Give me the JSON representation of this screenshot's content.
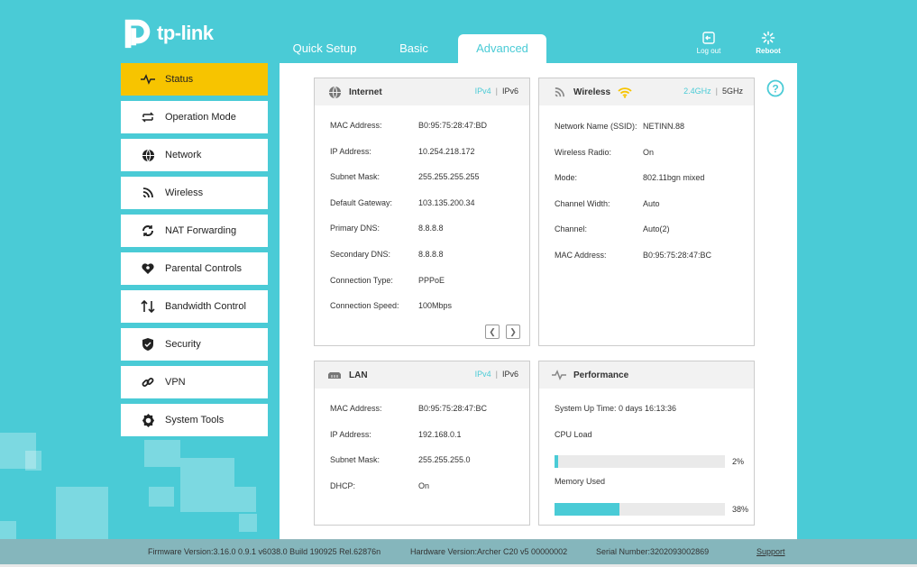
{
  "brand": {
    "logo_text": "tp-link"
  },
  "tabs": [
    {
      "label": "Quick Setup"
    },
    {
      "label": "Basic"
    },
    {
      "label": "Advanced",
      "active": true
    }
  ],
  "header_buttons": {
    "logout": "Log out",
    "reboot": "Reboot"
  },
  "sidebar": {
    "items": [
      {
        "label": "Status",
        "icon": "pulse-icon",
        "active": true
      },
      {
        "label": "Operation Mode",
        "icon": "switch-arrows-icon"
      },
      {
        "label": "Network",
        "icon": "globe-icon"
      },
      {
        "label": "Wireless",
        "icon": "wifi-icon"
      },
      {
        "label": "NAT Forwarding",
        "icon": "refresh-icon"
      },
      {
        "label": "Parental Controls",
        "icon": "heart-icon"
      },
      {
        "label": "Bandwidth Control",
        "icon": "up-down-arrows-icon"
      },
      {
        "label": "Security",
        "icon": "shield-icon"
      },
      {
        "label": "VPN",
        "icon": "link-icon"
      },
      {
        "label": "System Tools",
        "icon": "gear-icon"
      }
    ]
  },
  "internet": {
    "title": "Internet",
    "ipv4": "IPv4",
    "ipv6": "IPv6",
    "rows": [
      {
        "label": "MAC Address:",
        "value": "B0:95:75:28:47:BD"
      },
      {
        "label": "IP Address:",
        "value": "10.254.218.172"
      },
      {
        "label": "Subnet Mask:",
        "value": "255.255.255.255"
      },
      {
        "label": "Default Gateway:",
        "value": "103.135.200.34"
      },
      {
        "label": "Primary DNS:",
        "value": "8.8.8.8"
      },
      {
        "label": "Secondary DNS:",
        "value": "8.8.8.8"
      },
      {
        "label": "Connection Type:",
        "value": "PPPoE"
      },
      {
        "label": "Connection Speed:",
        "value": "100Mbps"
      }
    ]
  },
  "wireless": {
    "title": "Wireless",
    "band24": "2.4GHz",
    "band5": "5GHz",
    "rows": [
      {
        "label": "Network Name (SSID):",
        "value": "NETINN.88"
      },
      {
        "label": "Wireless Radio:",
        "value": "On"
      },
      {
        "label": "Mode:",
        "value": "802.11bgn mixed"
      },
      {
        "label": "Channel Width:",
        "value": "Auto"
      },
      {
        "label": "Channel:",
        "value": "Auto(2)"
      },
      {
        "label": "MAC Address:",
        "value": "B0:95:75:28:47:BC"
      }
    ]
  },
  "lan": {
    "title": "LAN",
    "ipv4": "IPv4",
    "ipv6": "IPv6",
    "rows": [
      {
        "label": "MAC Address:",
        "value": "B0:95:75:28:47:BC"
      },
      {
        "label": "IP Address:",
        "value": "192.168.0.1"
      },
      {
        "label": "Subnet Mask:",
        "value": "255.255.255.0"
      },
      {
        "label": "DHCP:",
        "value": "On"
      }
    ]
  },
  "performance": {
    "title": "Performance",
    "uptime": "System Up Time: 0 days 16:13:36",
    "cpu_label": "CPU Load",
    "cpu_percent": 2,
    "cpu_text": "2%",
    "memory_label": "Memory Used",
    "memory_percent": 38,
    "memory_text": "38%"
  },
  "footer": {
    "firmware": "Firmware Version:3.16.0 0.9.1 v6038.0 Build 190925 Rel.62876n",
    "hardware": "Hardware Version:Archer C20 v5 00000002",
    "serial": "Serial Number:3202093002869",
    "support": "Support"
  },
  "colors": {
    "accent": "#4acbd6",
    "active_nav": "#f7c400",
    "wifi_icon": "#f7c400"
  }
}
